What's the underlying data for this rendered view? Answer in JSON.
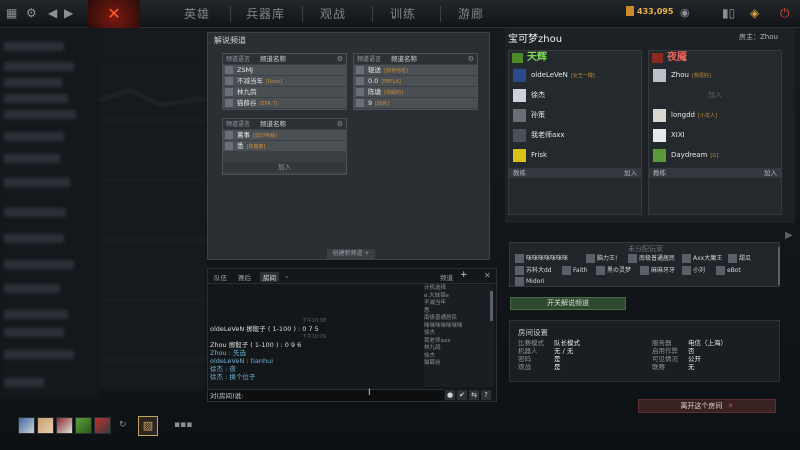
{
  "nav": {
    "tabs": [
      {
        "label": "英雄"
      },
      {
        "label": "兵器库"
      },
      {
        "label": "观战"
      },
      {
        "label": "训练"
      },
      {
        "label": "游廊"
      }
    ],
    "gold": "433,095"
  },
  "broadcast": {
    "title": "解说频道",
    "channels": [
      {
        "lang": "频道语言",
        "name": "频道名称",
        "members": [
          {
            "name": "ZSMJ",
            "tag": ""
          },
          {
            "name": "不减当年",
            "tag": "[Rose]"
          },
          {
            "name": "林九鸽",
            "tag": ""
          },
          {
            "name": "猫薛谷",
            "tag": "[EPA 7]"
          }
        ]
      },
      {
        "lang": "频道语言",
        "name": "频道名称",
        "members": [
          {
            "name": "辊送",
            "tag": "[骸骨哈哈]"
          },
          {
            "name": "0.0",
            "tag": "[PBFLA]"
          },
          {
            "name": "陈塘",
            "tag": "[晴朗的]"
          },
          {
            "name": "9",
            "tag": "[骸骨]"
          }
        ]
      },
      {
        "lang": "频道语言",
        "name": "频道名称",
        "members": [
          {
            "name": "蓠事",
            "tag": "[韵印陶裁]"
          },
          {
            "name": "悉",
            "tag": "[夜魔秦]"
          }
        ],
        "add": "加入"
      }
    ],
    "new_channel": "创建新频道 +"
  },
  "chat": {
    "tabs": [
      "队伍",
      "赛后",
      "房间"
    ],
    "channel_label": "频道",
    "log": [
      {
        "type": "divider",
        "text": "下午10:08"
      },
      {
        "type": "msg",
        "text": "oldeLeVeN 掷骰子 ( 1-100 ) : 0 7 5"
      },
      {
        "type": "divider",
        "text": "下午10:09"
      },
      {
        "type": "msg",
        "text": "Zhou 掷骰子 ( 1-100 ) : 0 9 6"
      },
      {
        "type": "msg",
        "text": "Zhou : 先选"
      },
      {
        "type": "msg",
        "text": "oldeLeVeN : tianhui"
      },
      {
        "type": "msg",
        "text": "徐杰 : 夜"
      },
      {
        "type": "msg",
        "text": "徐杰 : 换个位子"
      }
    ],
    "list": [
      "计机选择",
      "e.大妹锦e",
      "不减当年",
      "悉",
      "南极普通居民",
      "咪咪咪咪咪咪咪",
      "徐杰",
      "我老师axx",
      "林九鸽",
      "徐杰",
      "猫薛谷"
    ],
    "input": "对(房间)说:"
  },
  "room": {
    "title": "宝可梦zhou",
    "host": "房主：Zhou",
    "radiant": {
      "name": "天辉",
      "color": "#7ed957",
      "slots": [
        {
          "name": "oldeLeVeN",
          "tag": "[女王一樽]"
        },
        {
          "name": "徐杰",
          "tag": ""
        },
        {
          "name": "孙策",
          "tag": ""
        },
        {
          "name": "我老师axx",
          "tag": ""
        },
        {
          "name": "Frisk",
          "tag": ""
        }
      ],
      "coach": "教练",
      "join": "加入"
    },
    "dire": {
      "name": "夜魇",
      "color": "#e8655a",
      "slots": [
        {
          "name": "Zhou",
          "tag": "[我很好]"
        },
        {
          "name": "",
          "tag": "",
          "empty": "加入"
        },
        {
          "name": "longdd",
          "tag": "[小龙人]"
        },
        {
          "name": "XIXI",
          "tag": ""
        },
        {
          "name": "Daydream",
          "tag": "[G]"
        }
      ],
      "coach": "教练",
      "join": "加入"
    },
    "unassigned_title": "未分配玩家",
    "unassigned": [
      "咪咪咪咪咪咪咪",
      "脑力王!",
      "南极普通居民",
      "Axx大魔王",
      "甜瓜",
      "苏科大dd",
      "Faith",
      "黑の灵梦",
      "麻麻牙牙",
      "小刘",
      "eBot",
      "Midori"
    ],
    "toggle_broadcast": "开关解说频道",
    "settings_title": "房间设置",
    "settings_left": [
      {
        "k": "比赛模式",
        "v": "队长模式"
      },
      {
        "k": "机器人",
        "v": "无 / 无"
      },
      {
        "k": "密码",
        "v": "是"
      },
      {
        "k": "观战",
        "v": "是"
      }
    ],
    "settings_right": [
      {
        "k": "服务器",
        "v": "电信（上海）"
      },
      {
        "k": "启用作弊",
        "v": "否"
      },
      {
        "k": "可见情况",
        "v": "公开"
      },
      {
        "k": "联赛",
        "v": "无"
      }
    ],
    "leave": "离开这个房间"
  }
}
